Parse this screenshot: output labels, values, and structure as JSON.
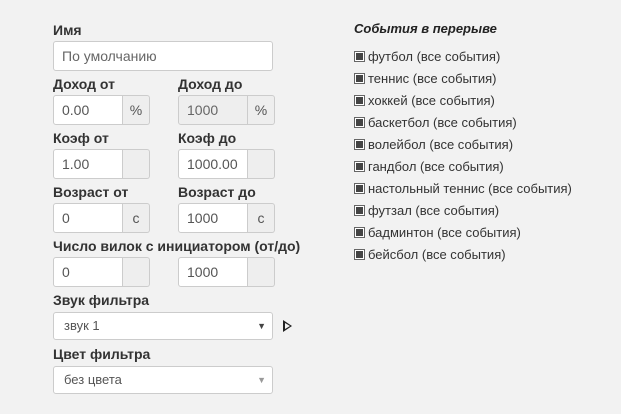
{
  "form": {
    "name_label": "Имя",
    "name_placeholder": "По умолчанию",
    "income_from_label": "Доход от",
    "income_from_value": "0.00",
    "income_from_unit": "%",
    "income_to_label": "Доход до",
    "income_to_value": "1000",
    "income_to_unit": "%",
    "coef_from_label": "Коэф от",
    "coef_from_value": "1.00",
    "coef_to_label": "Коэф до",
    "coef_to_value": "1000.00",
    "age_from_label": "Возраст от",
    "age_from_value": "0",
    "age_from_unit": "с",
    "age_to_label": "Возраст до",
    "age_to_value": "1000",
    "age_to_unit": "с",
    "forks_label": "Число вилок с инициатором (от/до)",
    "forks_from_value": "0",
    "forks_to_value": "1000",
    "sound_label": "Звук фильтра",
    "sound_value": "звук 1",
    "color_label": "Цвет фильтра",
    "color_value": "без цвета"
  },
  "events": {
    "title": "События в перерыве",
    "items": [
      {
        "label": "футбол (все события)",
        "checked": true
      },
      {
        "label": "теннис (все события)",
        "checked": true
      },
      {
        "label": "хоккей (все события)",
        "checked": true
      },
      {
        "label": "баскетбол (все события)",
        "checked": true
      },
      {
        "label": "волейбол (все события)",
        "checked": true
      },
      {
        "label": "гандбол (все события)",
        "checked": true
      },
      {
        "label": "настольный теннис (все события)",
        "checked": true
      },
      {
        "label": "футзал (все события)",
        "checked": true
      },
      {
        "label": "бадминтон (все события)",
        "checked": true
      },
      {
        "label": "бейсбол (все события)",
        "checked": true
      }
    ]
  }
}
